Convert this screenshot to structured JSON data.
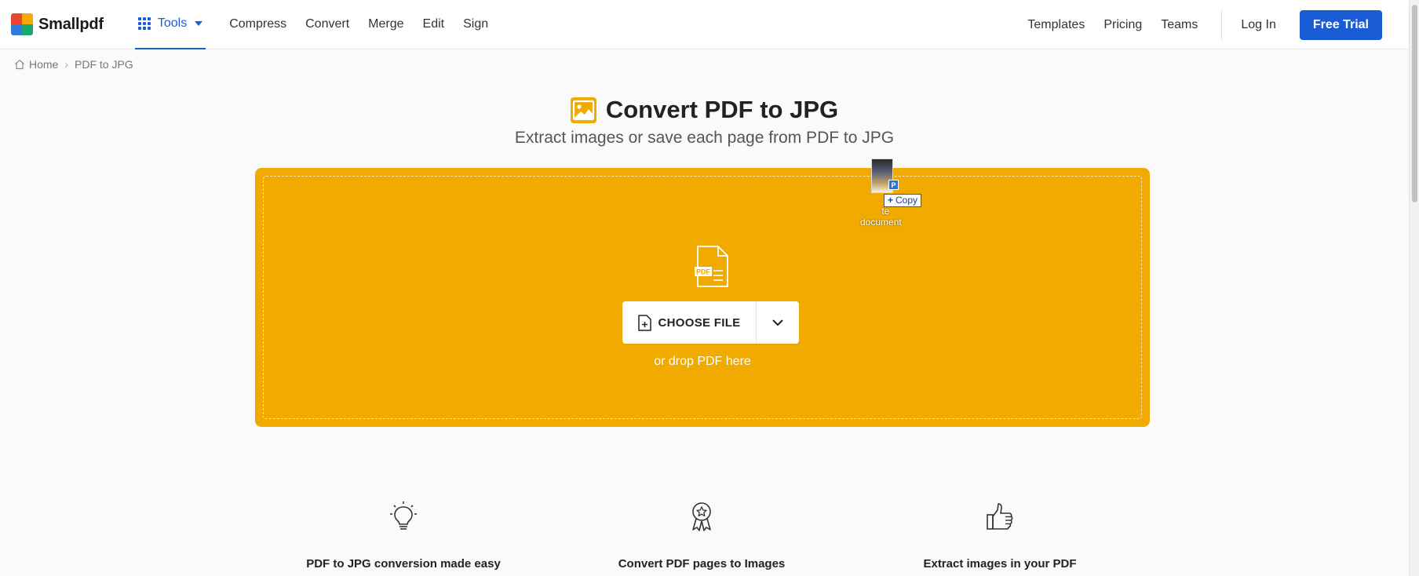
{
  "brand": {
    "name": "Smallpdf",
    "logo_colors": [
      "#e8462c",
      "#f6a800",
      "#2f7bdc",
      "#19a86b"
    ]
  },
  "header": {
    "tools_label": "Tools",
    "nav": [
      "Compress",
      "Convert",
      "Merge",
      "Edit",
      "Sign"
    ],
    "right_nav": [
      "Templates",
      "Pricing",
      "Teams"
    ],
    "login": "Log In",
    "trial": "Free Trial"
  },
  "breadcrumb": {
    "home": "Home",
    "separator": "›",
    "current": "PDF to JPG"
  },
  "hero": {
    "title": "Convert PDF to JPG",
    "subtitle": "Extract images or save each page from PDF to JPG",
    "icon": "image-icon"
  },
  "dropzone": {
    "choose_file": "CHOOSE FILE",
    "drop_text": "or drop PDF here",
    "file_icon_label": "PDF",
    "color": "#f0aa00"
  },
  "drag_ghost": {
    "copy_label": "Copy",
    "plus": "+",
    "badge": "P",
    "file_label_line1": "te",
    "file_label_line2": "document"
  },
  "features": [
    {
      "label": "PDF to JPG conversion made easy",
      "icon": "lightbulb-icon"
    },
    {
      "label": "Convert PDF pages to Images",
      "icon": "award-ribbon-icon"
    },
    {
      "label": "Extract images in your PDF",
      "icon": "thumbs-up-icon"
    }
  ],
  "colors": {
    "accent": "#1a5cd6",
    "dropzone": "#f0aa00"
  }
}
